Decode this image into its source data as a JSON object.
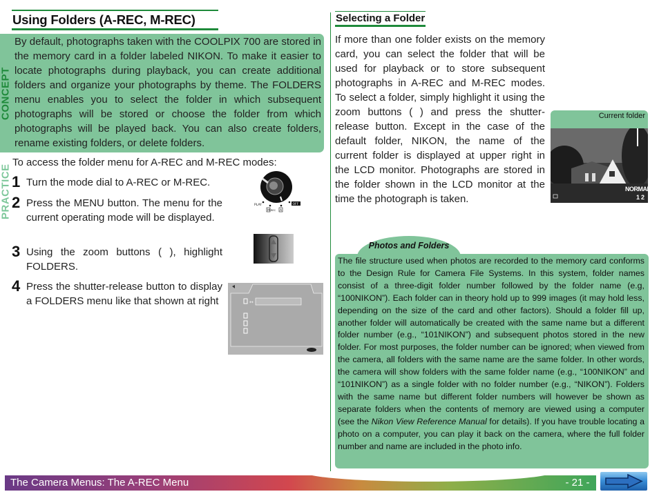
{
  "left": {
    "title": "Using Folders (A-REC, M-REC)",
    "concept_label": "CONCEPT",
    "concept_text": "By default, photographs taken with the COOLPIX 700 are stored in the memory card in a folder labeled NIKON.  To make it easier to locate photographs during playback, you can create additional folders and organize your photographs by theme.  The FOLDERS menu enables you to select the folder in which subsequent photographs will be stored or choose the folder from which photographs will be played back.  You can also create folders, rename existing folders, or delete folders.",
    "practice_label": "PRACTICE",
    "intro": "To access the folder menu for A-REC and M-REC modes:",
    "steps": [
      {
        "num": "1",
        "text": "Turn the mode dial to A-REC or M-REC."
      },
      {
        "num": "2",
        "text": "Press the MENU button.  The menu for the current operating mode will be displayed."
      },
      {
        "num": "3",
        "text": "Using the zoom buttons (        ), highlight FOLDERS."
      },
      {
        "num": "4",
        "text": "Press the shutter-release button to display a FOLDERS menu like that shown at right"
      }
    ],
    "dial_labels": {
      "play": "PLAY",
      "rec": "REC",
      "m": "M",
      "a": "A",
      "off": "OFF"
    }
  },
  "right": {
    "subtitle": "Selecting a Folder",
    "select_text": "If more than one folder exists on the memory card, you can select the folder that will be used for playback or to store subsequent photographs in A-REC and M-REC modes. To select a folder, simply highlight it using the zoom buttons (        ) and press the shutter-release button.  Except in the case of the default folder, NIKON, the name of the current folder is displayed at upper right in the LCD monitor. Photographs are stored in the folder shown in the LCD monitor at the time the photograph is taken.",
    "lcd_label": "Current folder",
    "lcd_quality": "NORMAL",
    "lcd_count": "12",
    "note": {
      "title": "Photos and Folders",
      "text_before": "The file structure used when photos are recorded to the memory card conforms to the Design Rule for Camera File Systems.  In this system, folder names consist of a three-digit folder number followed by the folder name (e.g, “100NIKON”).  Each folder can in theory hold up to 999 images (it may hold less, depending on the size of the card and other factors).  Should a folder fill up, another folder will automatically be created with the same name but a different folder number (e.g., “101NIKON”) and subsequent photos stored in the new folder.  For most purposes, the folder number can be ignored; when viewed from the camera, all folders with the same name are the same folder.  In other words, the camera will show folders with the same folder name (e.g., “100NIKON” and “101NIKON”) as a single folder with no folder number (e.g., “NIKON”).  Folders with the same name but different folder numbers will however be shown as separate folders when the contents of memory are viewed using a computer (see the ",
      "text_italic": "Nikon View Reference Manual",
      "text_after": " for details).  If you have trouble locating a photo on a computer, you can play it back on the camera, where the full folder number and name are included in the photo info."
    }
  },
  "footer": {
    "title": "The Camera Menus: The A-REC Menu",
    "page": "- 21 -",
    "next_icon": "right-arrow-icon"
  },
  "colors": {
    "accent_green": "#1e8a3a",
    "box_green": "#80c49a",
    "practice_green": "#7dc79a"
  }
}
